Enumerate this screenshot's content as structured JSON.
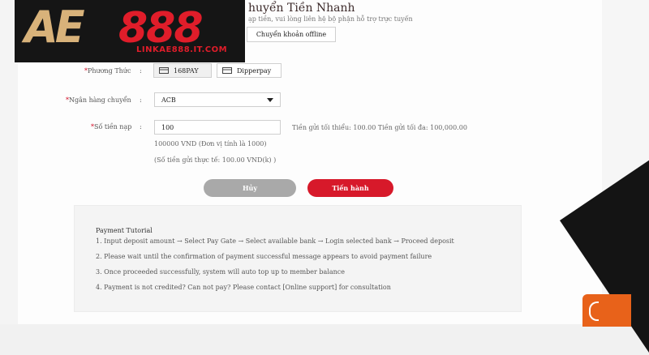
{
  "brand": {
    "logo_mark": "AE",
    "logo_number": "888",
    "logo_sub": "LINKAE888.IT.COM",
    "colors": {
      "gold": "#d8b27a",
      "red": "#e01d2a",
      "dark": "#151515"
    }
  },
  "header": {
    "title": "huyển Tiền Nhanh",
    "notice": "ạp tiền, vui lòng liên hệ bộ phận hỗ trợ trực tuyến",
    "offline_button": "Chuyển khoản offline"
  },
  "form": {
    "method": {
      "label": "Phương Thức",
      "options": [
        "168PAY",
        "Dipperpay"
      ],
      "selected": "168PAY"
    },
    "bank": {
      "label": "Ngân hàng chuyển",
      "value": "ACB"
    },
    "amount": {
      "label": "Số tiền nạp",
      "value": "100",
      "limits": "Tiền gửi tối thiểu: 100.00 Tiền gửi tối đa: 100,000.00",
      "conversion": "100000 VND (Đơn vị tính là 1000)",
      "actual": "(Số tiền gửi thực tế: 100.00 VND(k) )"
    },
    "colon": ":"
  },
  "actions": {
    "cancel": "Hủy",
    "proceed": "Tiến hành",
    "colors": {
      "cancel": "#a9a9a9",
      "proceed": "#d7192a"
    }
  },
  "tutorial": {
    "title": "Payment Tutorial",
    "steps": [
      "1. Input deposit amount → Select Pay Gate → Select available bank → Login selected bank → Proceed deposit",
      "2. Please wait until the confirmation of payment successful message appears to avoid payment failure",
      "3. Once proceeded successfully, system will auto top up to member balance",
      "4. Payment is not credited? Can not pay? Please contact [Online support] for consultation"
    ]
  },
  "icons": {
    "pay_icon": "card-icon",
    "dropdown": "chevron-down-icon",
    "support": "chat-icon"
  }
}
